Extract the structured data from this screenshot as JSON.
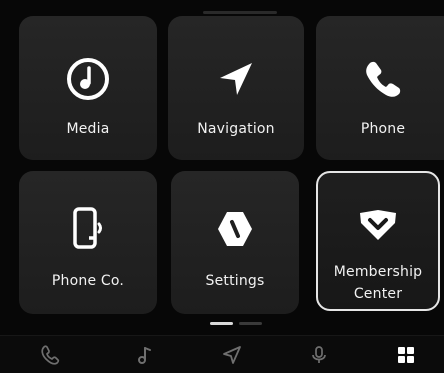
{
  "tiles": [
    {
      "label": "Media",
      "icon": "media-icon"
    },
    {
      "label": "Navigation",
      "icon": "navigation-arrow-icon"
    },
    {
      "label": "Phone",
      "icon": "phone-icon"
    },
    {
      "label": "Phone Co.",
      "icon": "phone-connect-icon"
    },
    {
      "label": "Settings",
      "icon": "settings-icon"
    },
    {
      "label": "Membership\nCenter",
      "icon": "membership-icon",
      "selected": true
    }
  ],
  "pager": {
    "pages": 2,
    "active_page": 1
  },
  "dock": {
    "items": [
      {
        "icon": "phone-icon",
        "active": false
      },
      {
        "icon": "music-note-icon",
        "active": false
      },
      {
        "icon": "navigation-arrow-icon",
        "active": false
      },
      {
        "icon": "microphone-icon",
        "active": false
      },
      {
        "icon": "app-grid-icon",
        "active": true
      }
    ]
  },
  "colors": {
    "background": "#070707",
    "tile": "#222222",
    "tile_text": "#f2f2f2",
    "selected_border": "#e6e6e6",
    "dock_icon_inactive": "#6f6f6f",
    "dock_icon_active": "#ffffff"
  }
}
